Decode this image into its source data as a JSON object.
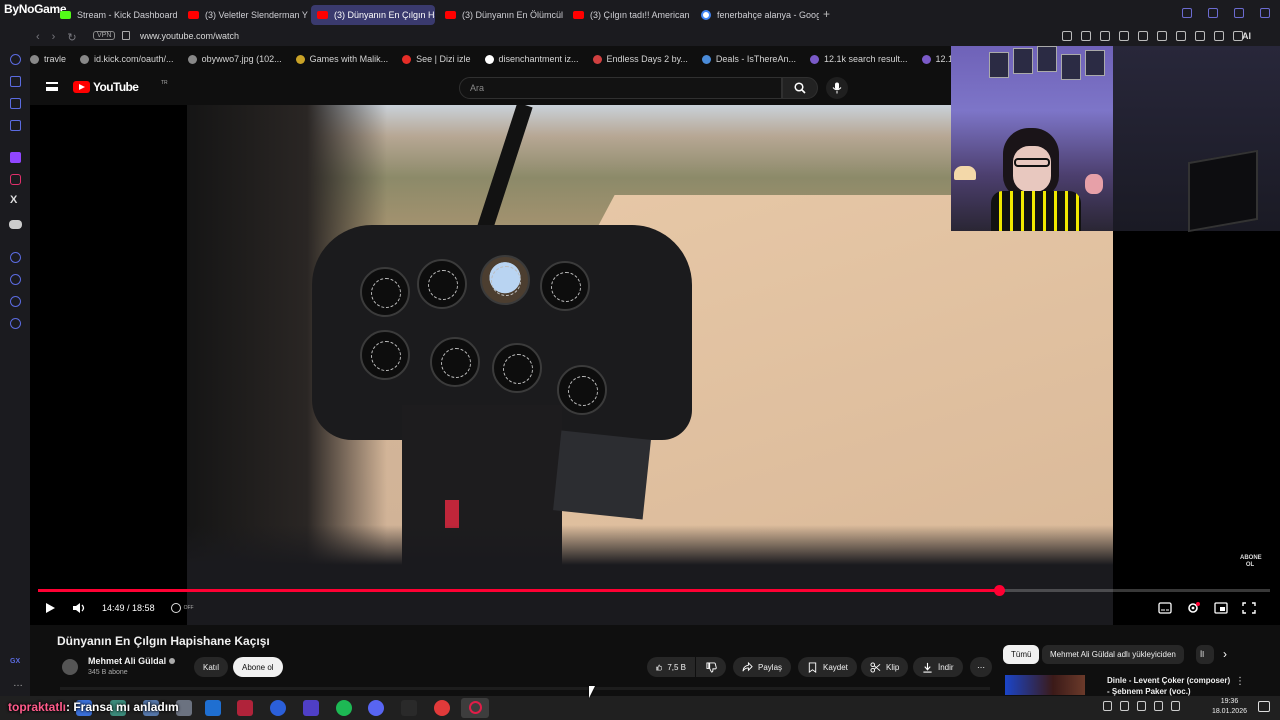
{
  "overlay": {
    "top_logo": "ByNoGame"
  },
  "tabs": [
    {
      "label": "Stream - Kick Dashboard",
      "favicon": "kick-icon"
    },
    {
      "label": "(3) Veletler Slenderman Y",
      "favicon": "youtube-icon"
    },
    {
      "label": "(3) Dünyanın En Çılgın Ha",
      "favicon": "youtube-icon",
      "active": true
    },
    {
      "label": "(3) Dünyanın En Ölümcül",
      "favicon": "youtube-icon"
    },
    {
      "label": "(3) Çılgın tadı!! American",
      "favicon": "youtube-icon"
    },
    {
      "label": "fenerbahçe alanya - Goog",
      "favicon": "google-icon"
    }
  ],
  "address": {
    "vpn_label": "VPN",
    "url": "www.youtube.com/watch",
    "ai_label": "AI"
  },
  "bookmarks": [
    {
      "label": "travle"
    },
    {
      "label": "id.kick.com/oauth/..."
    },
    {
      "label": "obywwo7.jpg (102..."
    },
    {
      "label": "Games with Malik..."
    },
    {
      "label": "See | Dizi izle"
    },
    {
      "label": "disenchantment iz..."
    },
    {
      "label": "Endless Days 2 by..."
    },
    {
      "label": "Deals - IsThereAn..."
    },
    {
      "label": "12.1k search result..."
    },
    {
      "label": "12.1k search res"
    }
  ],
  "youtube": {
    "logo_text": "YouTube",
    "region": "TR",
    "search_placeholder": "Ara"
  },
  "player": {
    "current_time": "14:49",
    "separator": " / ",
    "duration": "18:58",
    "progress_fraction": 0.78,
    "autoplay_label": "OFF",
    "watermark_line1": "ABONE",
    "watermark_line2": "OL"
  },
  "video": {
    "title": "Dünyanın En Çılgın Hapishane Kaçışı",
    "channel_name": "Mehmet Ali Güldal",
    "subscribers": "345 B abone",
    "join_label": "Katıl",
    "subscribe_label": "Abone ol",
    "like_count": "7,5 B",
    "share_label": "Paylaş",
    "save_label": "Kaydet",
    "clip_label": "Klip",
    "download_label": "İndir"
  },
  "chips": [
    {
      "label": "Tümü",
      "active": true
    },
    {
      "label": "Mehmet Ali Güldal adlı yükleyiciden"
    },
    {
      "label": "İl"
    }
  ],
  "recommendation": {
    "title_line1": "Dinle - Levent Çoker (composer)",
    "title_line2": "- Şebnem Paker (voc.)"
  },
  "taskbar": {
    "caption_user": "topraktatlı",
    "caption_text": ": Fransa mı anladım",
    "time": "19:36",
    "date": "18.01.2026"
  },
  "colors": {
    "youtube_red": "#ff0000",
    "progress_red": "#ff0033",
    "browser_bg": "#1b1b1f",
    "active_tab": "#3a3a6e"
  }
}
